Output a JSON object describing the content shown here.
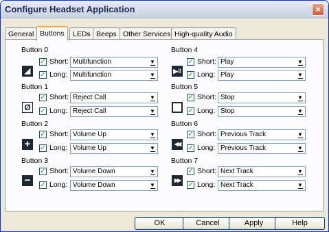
{
  "window": {
    "title": "Configure Headset Application",
    "close_label": "×"
  },
  "tabs": [
    "General",
    "Buttons",
    "LEDs",
    "Beeps",
    "Other Services",
    "High-quality Audio"
  ],
  "short_label": "Short:",
  "long_label": "Long:",
  "check_mark": "✓",
  "buttons": [
    {
      "name": "Button 0",
      "icon": "phone-icon",
      "glyph": "◢",
      "short": "Multifunction",
      "long": "Multifunction"
    },
    {
      "name": "Button 1",
      "icon": "reject-icon",
      "glyph": "Ø",
      "short": "Reject Call",
      "long": "Reject Call"
    },
    {
      "name": "Button 2",
      "icon": "plus-icon",
      "glyph": "+",
      "short": "Volume Up",
      "long": "Volume Up"
    },
    {
      "name": "Button 3",
      "icon": "minus-icon",
      "glyph": "−",
      "short": "Volume Down",
      "long": "Volume Down"
    },
    {
      "name": "Button 4",
      "icon": "play-pause-icon",
      "glyph": "▶‖",
      "short": "Play",
      "long": "Play"
    },
    {
      "name": "Button 5",
      "icon": "stop-icon",
      "glyph": "",
      "short": "Stop",
      "long": "Stop"
    },
    {
      "name": "Button 6",
      "icon": "previous-track-icon",
      "glyph": "◀◀",
      "short": "Previous Track",
      "long": "Previous Track"
    },
    {
      "name": "Button 7",
      "icon": "next-track-icon",
      "glyph": "▶▶",
      "short": "Next Track",
      "long": "Next Track"
    }
  ],
  "footer": {
    "ok": "OK",
    "cancel": "Cancel",
    "apply": "Apply",
    "help": "Help"
  }
}
